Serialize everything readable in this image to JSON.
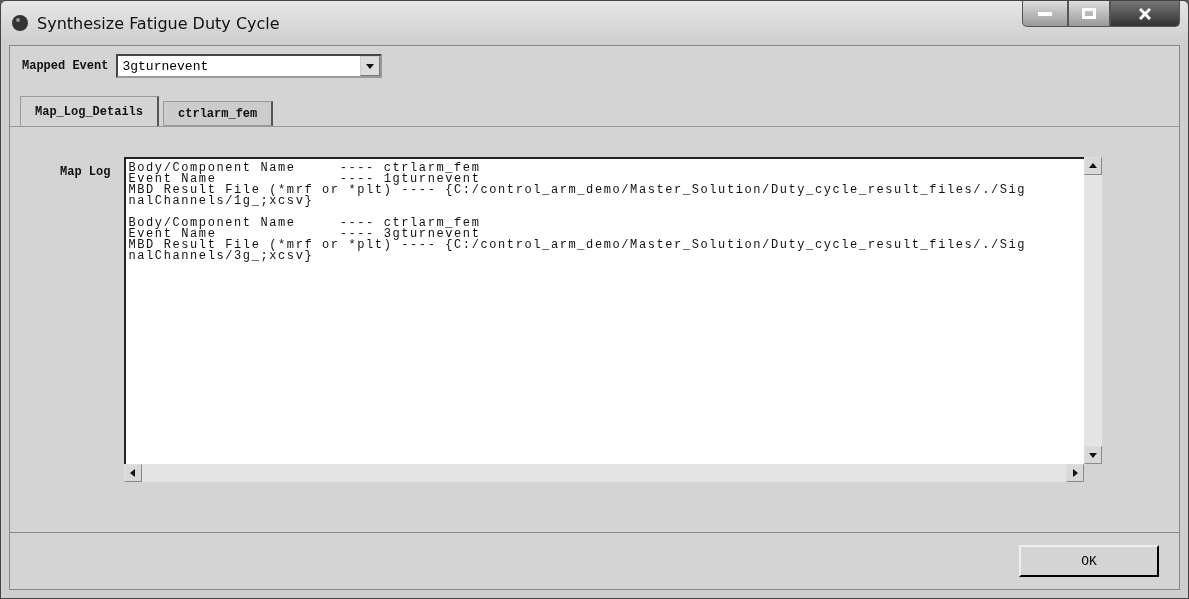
{
  "window": {
    "title": "Synthesize Fatigue Duty Cycle"
  },
  "mapped_event": {
    "label": "Mapped Event",
    "value": "3gturnevent"
  },
  "tabs": [
    {
      "label": "Map_Log_Details",
      "selected": true
    },
    {
      "label": "ctrlarm_fem",
      "selected": false
    }
  ],
  "map_log": {
    "label": "Map Log",
    "entries": [
      [
        "Body/Component Name     ---- ctrlarm_fem",
        "Event Name              ---- 1gturnevent",
        "MBD Result File (*mrf or *plt) ---- {C:/control_arm_demo/Master_Solution/Duty_cycle_result_files/./Sig",
        "nalChannels/1g_;xcsv}"
      ],
      [
        "Body/Component Name     ---- ctrlarm_fem",
        "Event Name              ---- 3gturnevent",
        "MBD Result File (*mrf or *plt) ---- {C:/control_arm_demo/Master_Solution/Duty_cycle_result_files/./Sig",
        "nalChannels/3g_;xcsv}"
      ]
    ]
  },
  "buttons": [
    "OK"
  ]
}
